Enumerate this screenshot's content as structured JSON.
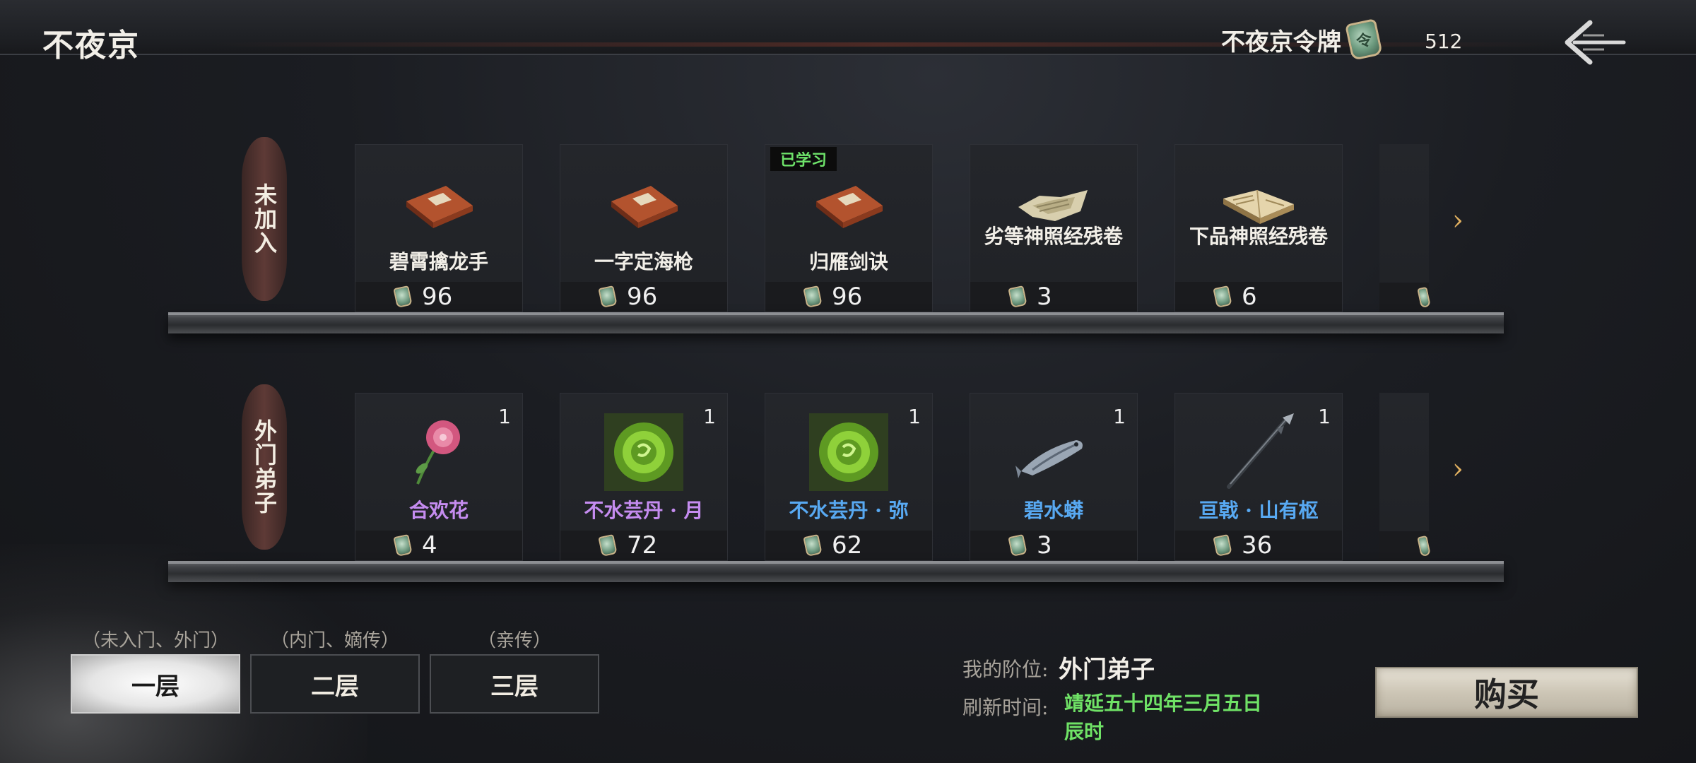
{
  "header": {
    "title": "不夜京",
    "currency_label": "不夜京令牌",
    "currency_amount": "512",
    "back_icon": "back-arrow-icon"
  },
  "rows": [
    {
      "label": "未加入",
      "items": [
        {
          "name": "碧霄擒龙手",
          "price": "96",
          "name_color": "#f2efe8",
          "art": "manual-book"
        },
        {
          "name": "一字定海枪",
          "price": "96",
          "name_color": "#f2efe8",
          "art": "manual-book"
        },
        {
          "name": "归雁剑诀",
          "price": "96",
          "name_color": "#f2efe8",
          "art": "manual-book",
          "badge": "已学习"
        },
        {
          "name": "劣等神照经残卷",
          "price": "3",
          "name_color": "#f2efe8",
          "art": "torn-scroll"
        },
        {
          "name": "下品神照经残卷",
          "price": "6",
          "name_color": "#f2efe8",
          "art": "open-book"
        }
      ]
    },
    {
      "label": "外门弟子",
      "items": [
        {
          "name": "合欢花",
          "price": "4",
          "count": "1",
          "name_color": "#c58cf0",
          "art": "flower"
        },
        {
          "name": "不水芸丹 · 月",
          "price": "72",
          "count": "1",
          "name_color": "#c58cf0",
          "art": "green-orb"
        },
        {
          "name": "不水芸丹 · 弥",
          "price": "62",
          "count": "1",
          "name_color": "#58a9f2",
          "art": "green-orb"
        },
        {
          "name": "碧水蟒",
          "price": "3",
          "count": "1",
          "name_color": "#58a9f2",
          "art": "fish"
        },
        {
          "name": "亘戟 · 山有枢",
          "price": "36",
          "count": "1",
          "name_color": "#58a9f2",
          "art": "spear"
        }
      ]
    }
  ],
  "tiers": [
    {
      "hint": "（未入门、外门）",
      "label": "一层",
      "active": true
    },
    {
      "hint": "（内门、嫡传）",
      "label": "二层",
      "active": false
    },
    {
      "hint": "（亲传）",
      "label": "三层",
      "active": false
    }
  ],
  "info": {
    "rank_label": "我的阶位:",
    "rank_value": "外门弟子",
    "refresh_label": "刷新时间:",
    "refresh_value": "靖延五十四年三月五日辰时"
  },
  "buy_label": "购买",
  "colors": {
    "learned_badge": "#6ee36a",
    "refresh_time": "#6fe266",
    "purple_item": "#c58cf0",
    "blue_item": "#58a9f2"
  }
}
